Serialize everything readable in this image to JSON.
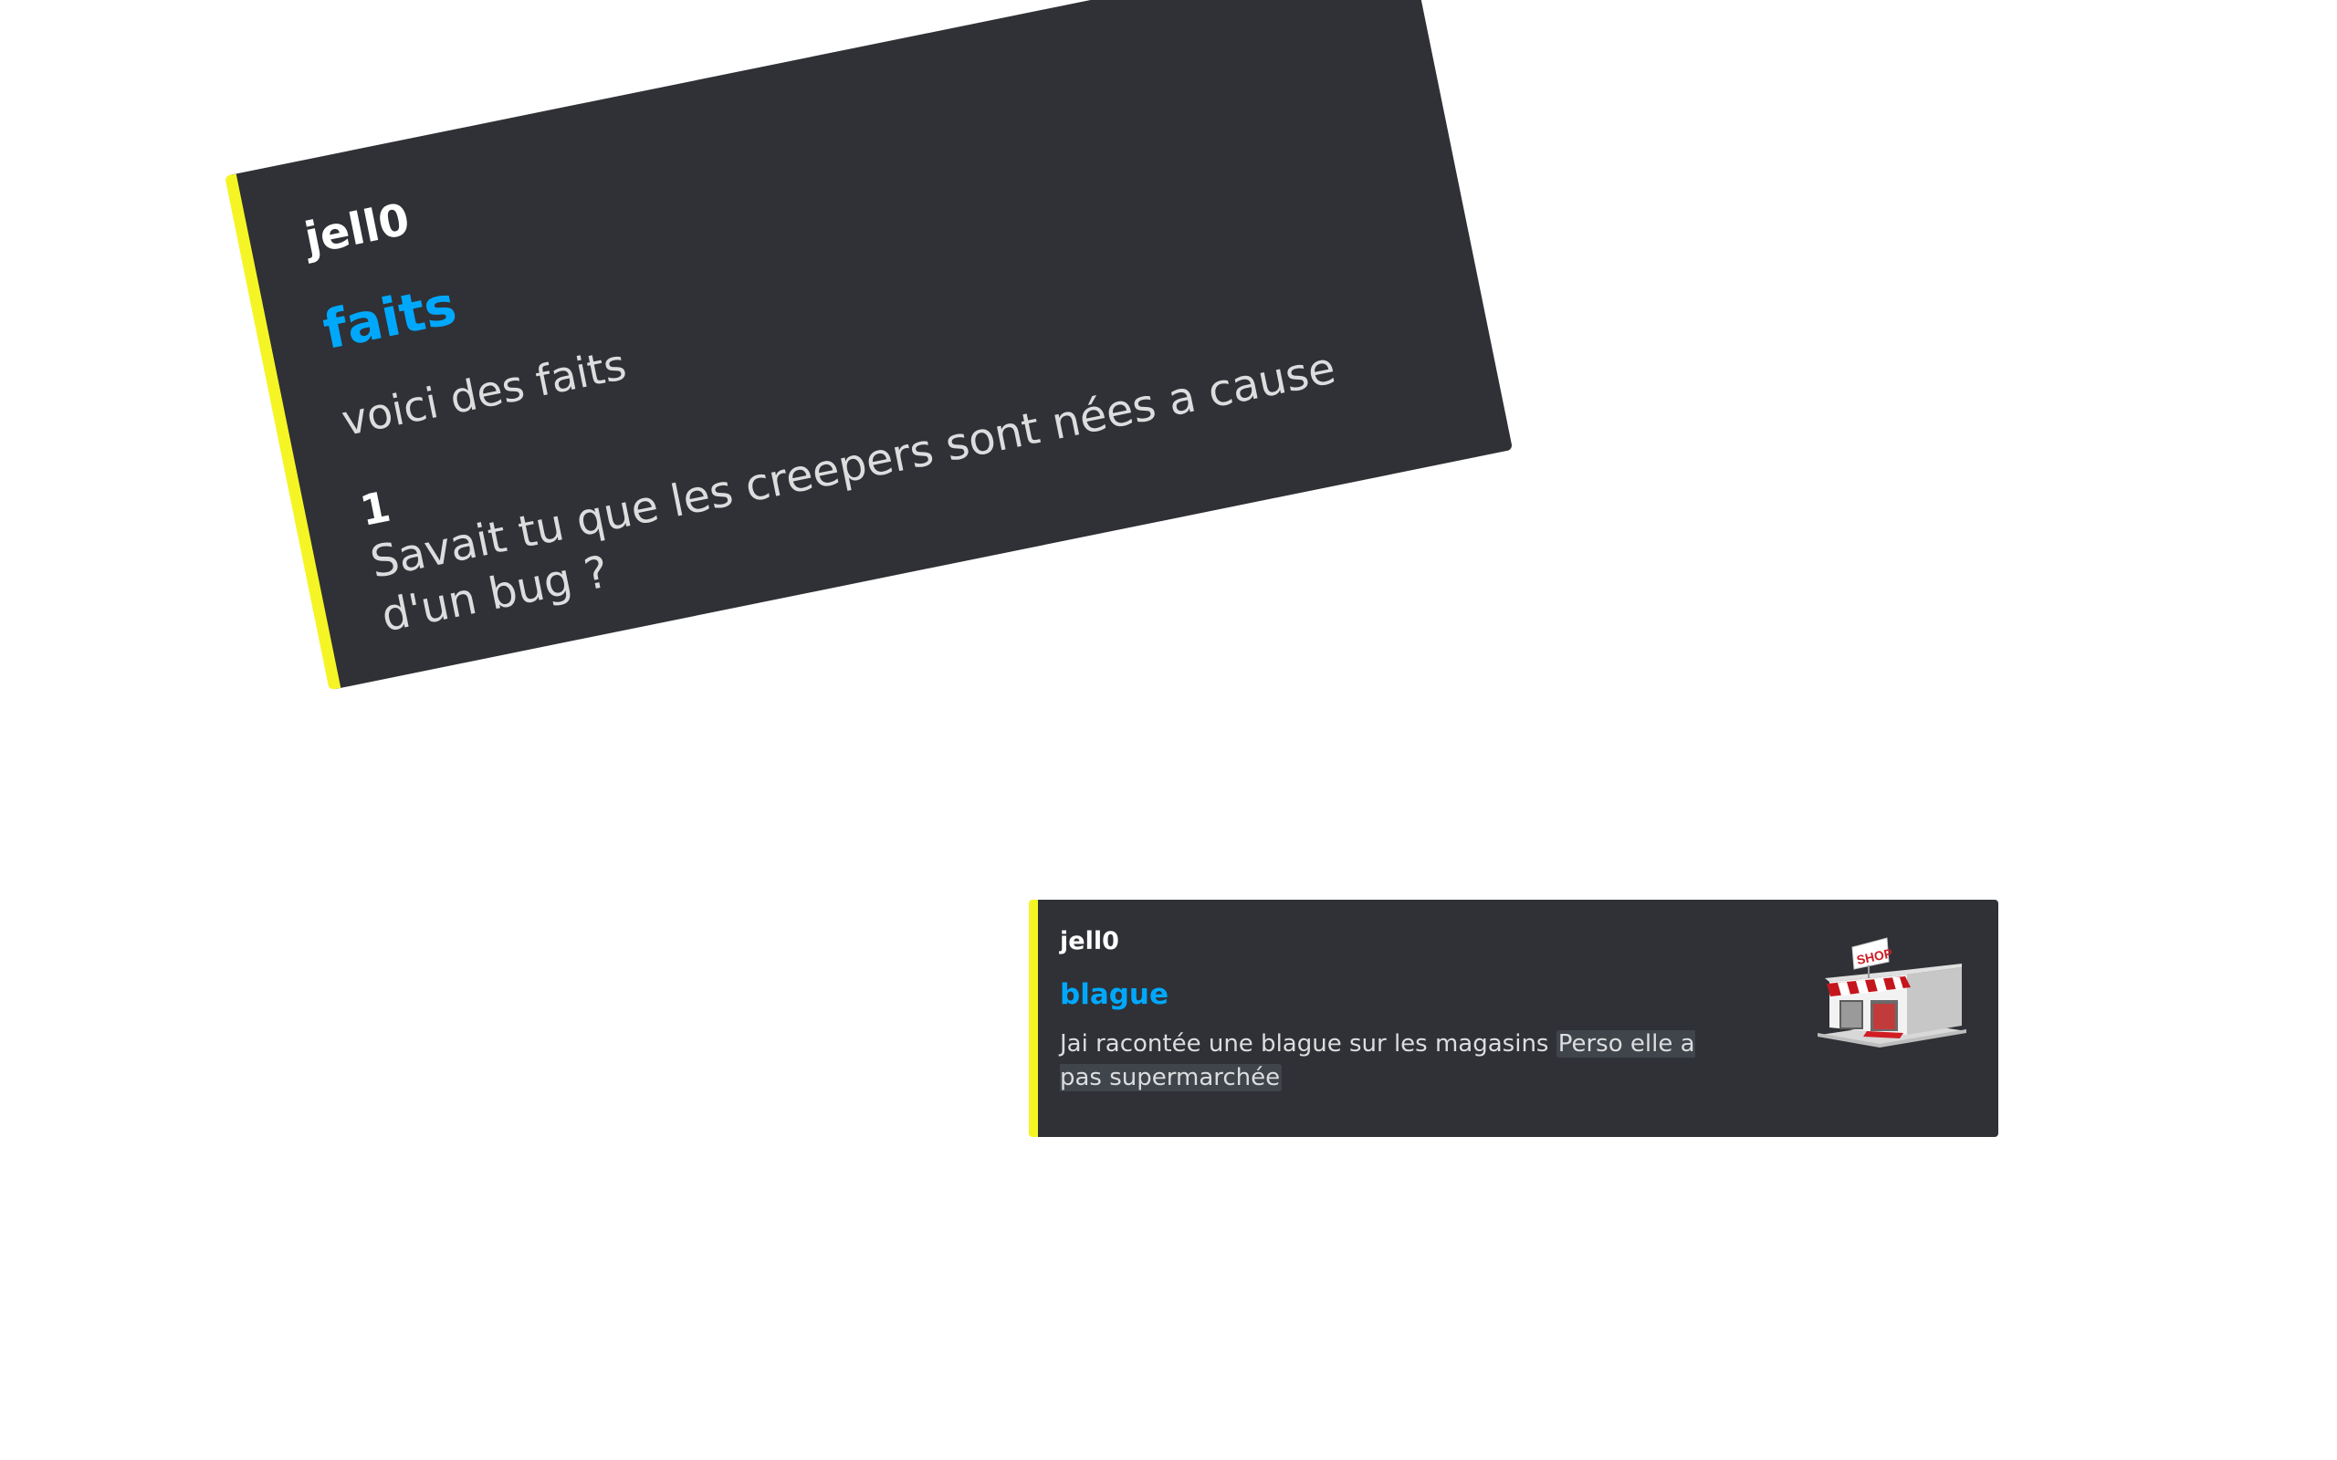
{
  "theme": {
    "embed_background": "#2f3136",
    "accent_bar": "#f5f525",
    "title_color": "#00a8fc",
    "author_color": "#ffffff",
    "text_color": "#dcddde"
  },
  "embeds": [
    {
      "author": "jell0",
      "title": "faits",
      "description": "voici des faits",
      "field": {
        "name": "1",
        "value": "Savait tu que les creepers sont nées a cause d'un bug ?"
      }
    },
    {
      "author": "jell0",
      "title": "blague",
      "description": "Jai racontée une blague sur les magasins ",
      "spoiler": "Perso elle a pas supermarchée",
      "thumbnail": {
        "icon": "shop-storefront-icon",
        "sign_text": "SHOP"
      }
    }
  ]
}
